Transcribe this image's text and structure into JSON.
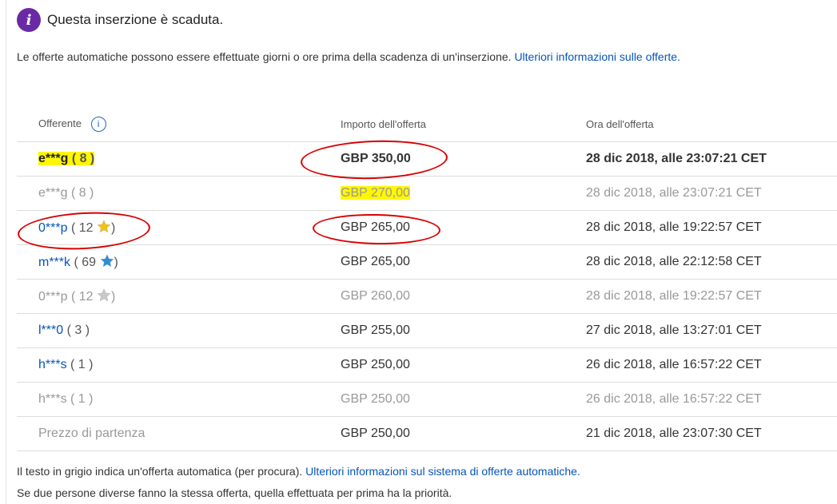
{
  "notice": {
    "icon": "info-icon",
    "icon_glyph": "i",
    "text": "Questa inserzione è scaduta."
  },
  "intro": {
    "text": "Le offerte automatiche possono essere effettuate giorni o ore prima della scadenza di un'inserzione.",
    "link": "Ulteriori informazioni sulle offerte."
  },
  "table": {
    "headers": {
      "bidder": "Offerente",
      "amount": "Importo dell'offerta",
      "time": "Ora dell'offerta",
      "info_glyph": "i"
    },
    "rows": [
      {
        "bidder": "e***g",
        "score": "( 8 )",
        "amount": "GBP 350,00",
        "time": "28 dic 2018, alle 23:07:21 CET",
        "style": "bold",
        "star": ""
      },
      {
        "bidder": "e***g",
        "score": "( 8 )",
        "amount": "GBP 270,00",
        "time": "28 dic 2018, alle 23:07:21 CET",
        "style": "grey",
        "star": ""
      },
      {
        "bidder": "0***p",
        "score_open": "( 12",
        "score_close": ")",
        "amount": "GBP 265,00",
        "time": "28 dic 2018, alle 19:22:57 CET",
        "style": "normal",
        "star": "yellow"
      },
      {
        "bidder": "m***k",
        "score_open": "( 69",
        "score_close": ")",
        "amount": "GBP 265,00",
        "time": "28 dic 2018, alle 22:12:58 CET",
        "style": "normal",
        "star": "blue"
      },
      {
        "bidder": "0***p",
        "score_open": "( 12",
        "score_close": ")",
        "amount": "GBP 260,00",
        "time": "28 dic 2018, alle 19:22:57 CET",
        "style": "grey",
        "star": "grey"
      },
      {
        "bidder": "l***0",
        "score": "( 3 )",
        "amount": "GBP 255,00",
        "time": "27 dic 2018, alle 13:27:01 CET",
        "style": "normal",
        "star": ""
      },
      {
        "bidder": "h***s",
        "score": "( 1 )",
        "amount": "GBP 250,00",
        "time": "26 dic 2018, alle 16:57:22 CET",
        "style": "normal",
        "star": ""
      },
      {
        "bidder": "h***s",
        "score": "( 1 )",
        "amount": "GBP 250,00",
        "time": "26 dic 2018, alle 16:57:22 CET",
        "style": "grey",
        "star": ""
      },
      {
        "bidder": "Prezzo di partenza",
        "score": "",
        "amount": "GBP 250,00",
        "time": "21 dic 2018, alle 23:07:30 CET",
        "style": "start",
        "star": ""
      }
    ]
  },
  "footer": {
    "line1_text": "Il testo in grigio indica un'offerta automatica (per procura).",
    "line1_link": "Ulteriori informazioni sul sistema di offerte automatiche.",
    "line2_text": "Se due persone diverse fanno la stessa offerta, quella effettuata per prima ha la priorità."
  },
  "colors": {
    "accent_purple": "#6a2aa6",
    "link_blue": "#0654ba",
    "highlight_yellow": "#fff700",
    "annotation_red": "#d80000",
    "star_yellow": "#f4c20d",
    "star_blue": "#2a8fd6",
    "star_grey": "#c8c8c8"
  }
}
